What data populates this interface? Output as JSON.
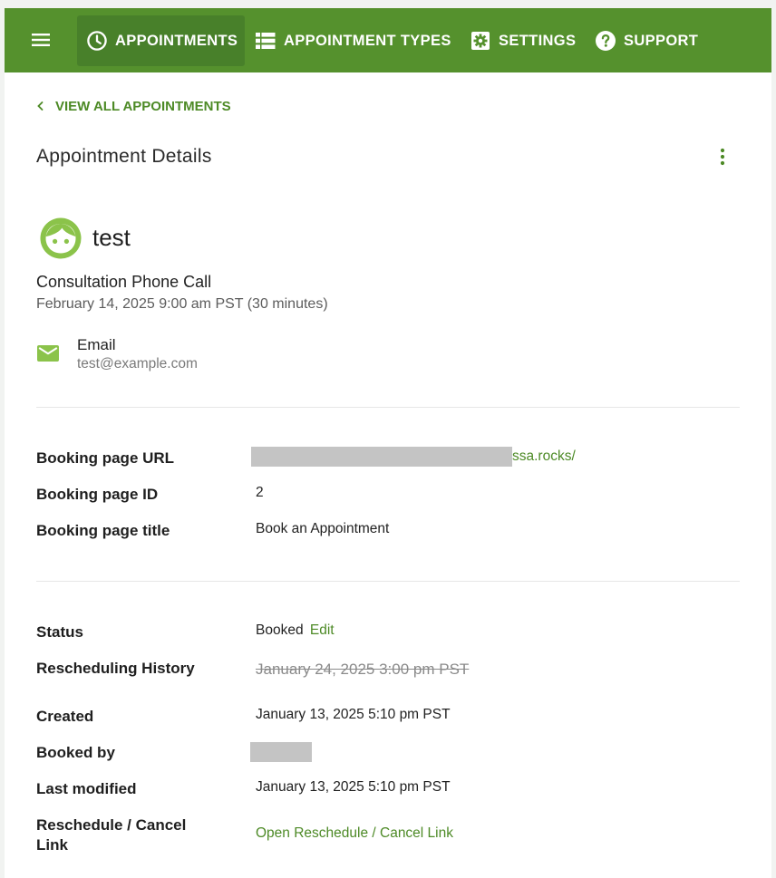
{
  "nav": {
    "items": [
      {
        "label": "APPOINTMENTS",
        "icon": "clock-icon",
        "active": true
      },
      {
        "label": "APPOINTMENT TYPES",
        "icon": "list-icon",
        "active": false
      },
      {
        "label": "SETTINGS",
        "icon": "gear-icon",
        "active": false
      },
      {
        "label": "SUPPORT",
        "icon": "help-icon",
        "active": false
      }
    ]
  },
  "back_link": "VIEW ALL APPOINTMENTS",
  "page_title": "Appointment Details",
  "customer": {
    "name": "test",
    "appointment_type": "Consultation Phone Call",
    "datetime": "February 14, 2025 9:00 am PST (30 minutes)",
    "email_label": "Email",
    "email_value": "test@example.com"
  },
  "booking": {
    "url_label": "Booking page URL",
    "url_value_visible": "ssa.rocks/",
    "id_label": "Booking page ID",
    "id_value": "2",
    "title_label": "Booking page title",
    "title_value": "Book an Appointment"
  },
  "details": {
    "status_label": "Status",
    "status_value": "Booked",
    "status_edit": "Edit",
    "history_label": "Rescheduling History",
    "history_value": "January 24, 2025 3:00 pm PST",
    "created_label": "Created",
    "created_value": "January 13, 2025 5:10 pm PST",
    "booked_by_label": "Booked by",
    "last_modified_label": "Last modified",
    "last_modified_value": "January 13, 2025 5:10 pm PST",
    "reschedule_label_line1": "Reschedule / Cancel",
    "reschedule_label_line2": "Link",
    "reschedule_link": "Open Reschedule / Cancel Link"
  },
  "colors": {
    "brand": "#55912d",
    "brand_active": "#48802a",
    "link": "#4d8a26",
    "avatar": "#8bc34a"
  }
}
